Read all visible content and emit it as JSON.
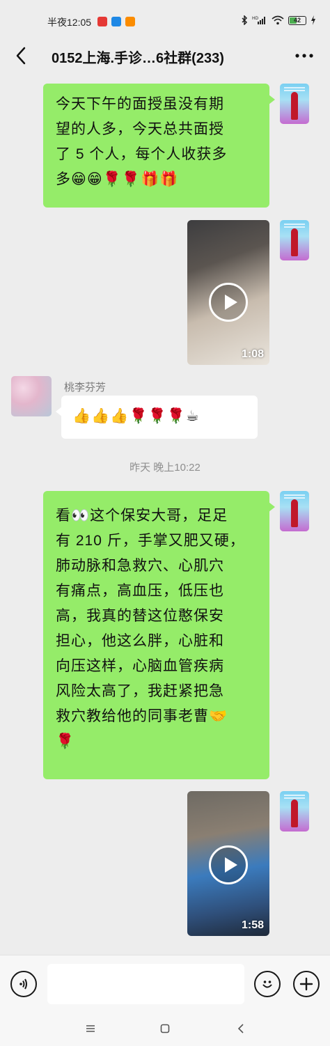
{
  "status_bar": {
    "time": "半夜12:05",
    "battery": "42",
    "icons": [
      "red-app-icon",
      "blue-app-icon",
      "orange-app-icon",
      "bluetooth-icon",
      "hd-signal-icon",
      "wifi-icon",
      "battery-icon",
      "charging-icon"
    ]
  },
  "header": {
    "title": "0152上海.手诊…6社群(233)",
    "back_icon": "back-chevron-icon",
    "more_icon": "more-dots-icon"
  },
  "messages": [
    {
      "type": "text",
      "sender": "self",
      "lines": [
        "今天下午的面授虽没有期",
        "望的人多，今天总共面授",
        "了 5 个人，每个人收获多",
        "多😁😁🌹🌹🎁🎁"
      ]
    },
    {
      "type": "video",
      "sender": "self",
      "duration": "1:08"
    },
    {
      "type": "text",
      "sender": "peer",
      "sender_name": "桃李芬芳",
      "lines": [
        "👍👍👍🌹🌹🌹☕"
      ]
    },
    {
      "type": "timestamp",
      "text": "昨天 晚上10:22"
    },
    {
      "type": "text",
      "sender": "self",
      "lines": [
        "看👀这个保安大哥，足足",
        "有 210 斤，手掌又肥又硬，",
        "肺动脉和急救穴、心肌穴",
        "有痛点，高血压，低压也",
        "高，我真的替这位憨保安",
        "担心，他这么胖，心脏和",
        "向压这样，心脑血管疾病",
        "风险太高了，我赶紧把急",
        "救穴教给他的同事老曹🤝",
        "🌹"
      ]
    },
    {
      "type": "video",
      "sender": "self",
      "duration": "1:58"
    }
  ],
  "input_bar": {
    "voice_icon": "voice-icon",
    "emoji_icon": "emoji-icon",
    "add_icon": "plus-icon",
    "input_value": ""
  },
  "system_nav": {
    "icons": [
      "menu-icon",
      "home-icon",
      "back-icon"
    ]
  },
  "colors": {
    "background": "#ededed",
    "self_bubble": "#95ec69",
    "peer_bubble": "#ffffff",
    "timestamp_text": "#8e8e8e"
  }
}
